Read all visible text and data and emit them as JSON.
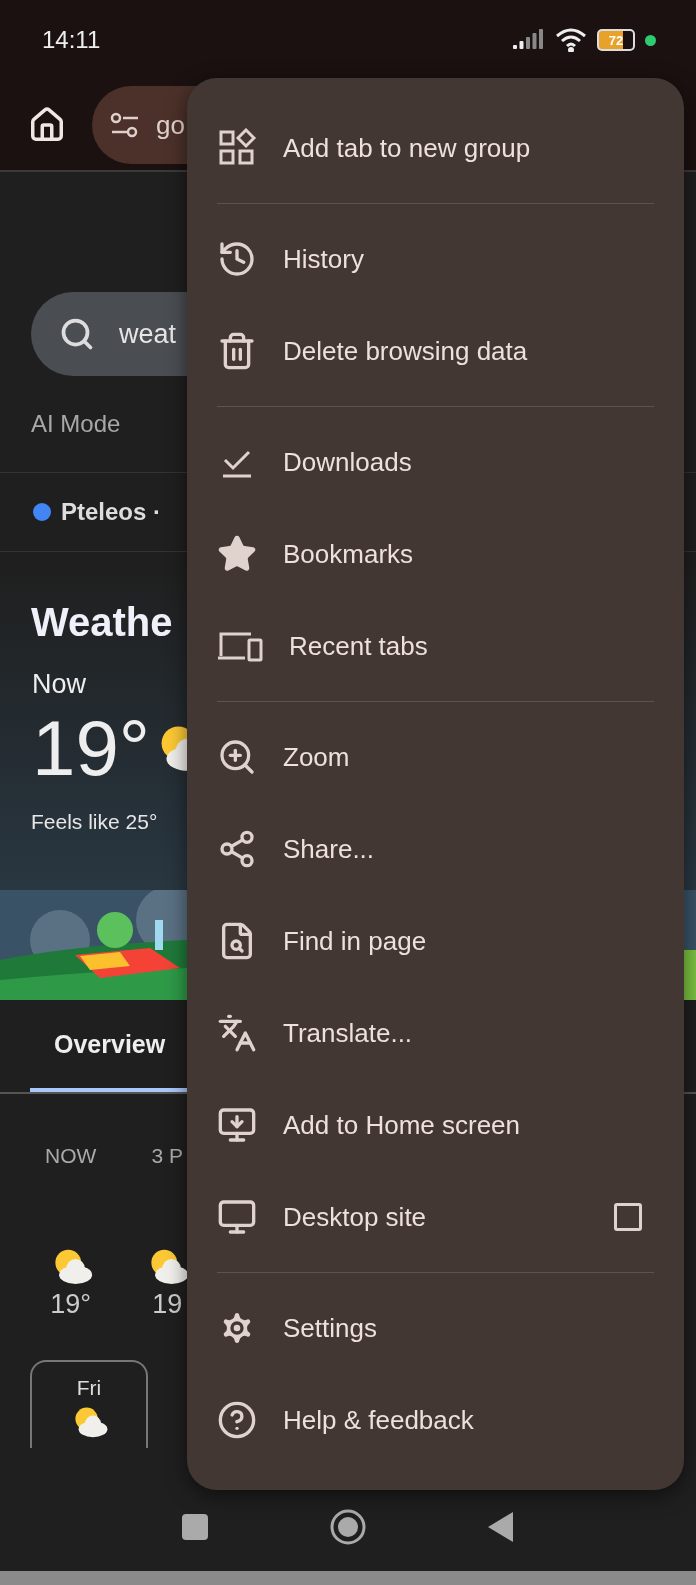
{
  "status_bar": {
    "time": "14:11",
    "battery": "72"
  },
  "toolbar": {
    "url": "go"
  },
  "page": {
    "search": {
      "value": "weat"
    },
    "tabs": [
      {
        "label": "AI Mode",
        "selected": false
      }
    ],
    "location": {
      "name": "Pteleos ·",
      "color": "#4285f4"
    },
    "weather": {
      "title": "Weathe",
      "now_label": "Now",
      "temperature": "19°",
      "feels_like": "Feels like 25°"
    },
    "section_tabs": [
      {
        "label": "Overview",
        "selected": true
      }
    ],
    "hourly": [
      {
        "time": "NOW",
        "temp": "19°"
      },
      {
        "time": "3 P",
        "temp": "19"
      }
    ],
    "daily": [
      {
        "day": "Fri"
      }
    ]
  },
  "menu": {
    "groups": [
      [
        {
          "kind": "item",
          "label": "Add tab to new group"
        }
      ],
      [
        {
          "kind": "item",
          "label": "History"
        },
        {
          "kind": "item",
          "label": "Delete browsing data"
        }
      ],
      [
        {
          "kind": "item",
          "label": "Downloads"
        },
        {
          "kind": "item",
          "label": "Bookmarks"
        },
        {
          "kind": "item",
          "label": "Recent tabs"
        }
      ],
      [
        {
          "kind": "item",
          "label": "Zoom"
        },
        {
          "kind": "item",
          "label": "Share..."
        },
        {
          "kind": "item",
          "label": "Find in page"
        },
        {
          "kind": "item",
          "label": "Translate..."
        },
        {
          "kind": "item",
          "label": "Add to Home screen"
        },
        {
          "kind": "checkbox",
          "label": "Desktop site",
          "checked": false
        }
      ],
      [
        {
          "kind": "item",
          "label": "Settings"
        },
        {
          "kind": "item",
          "label": "Help & feedback"
        }
      ]
    ]
  }
}
